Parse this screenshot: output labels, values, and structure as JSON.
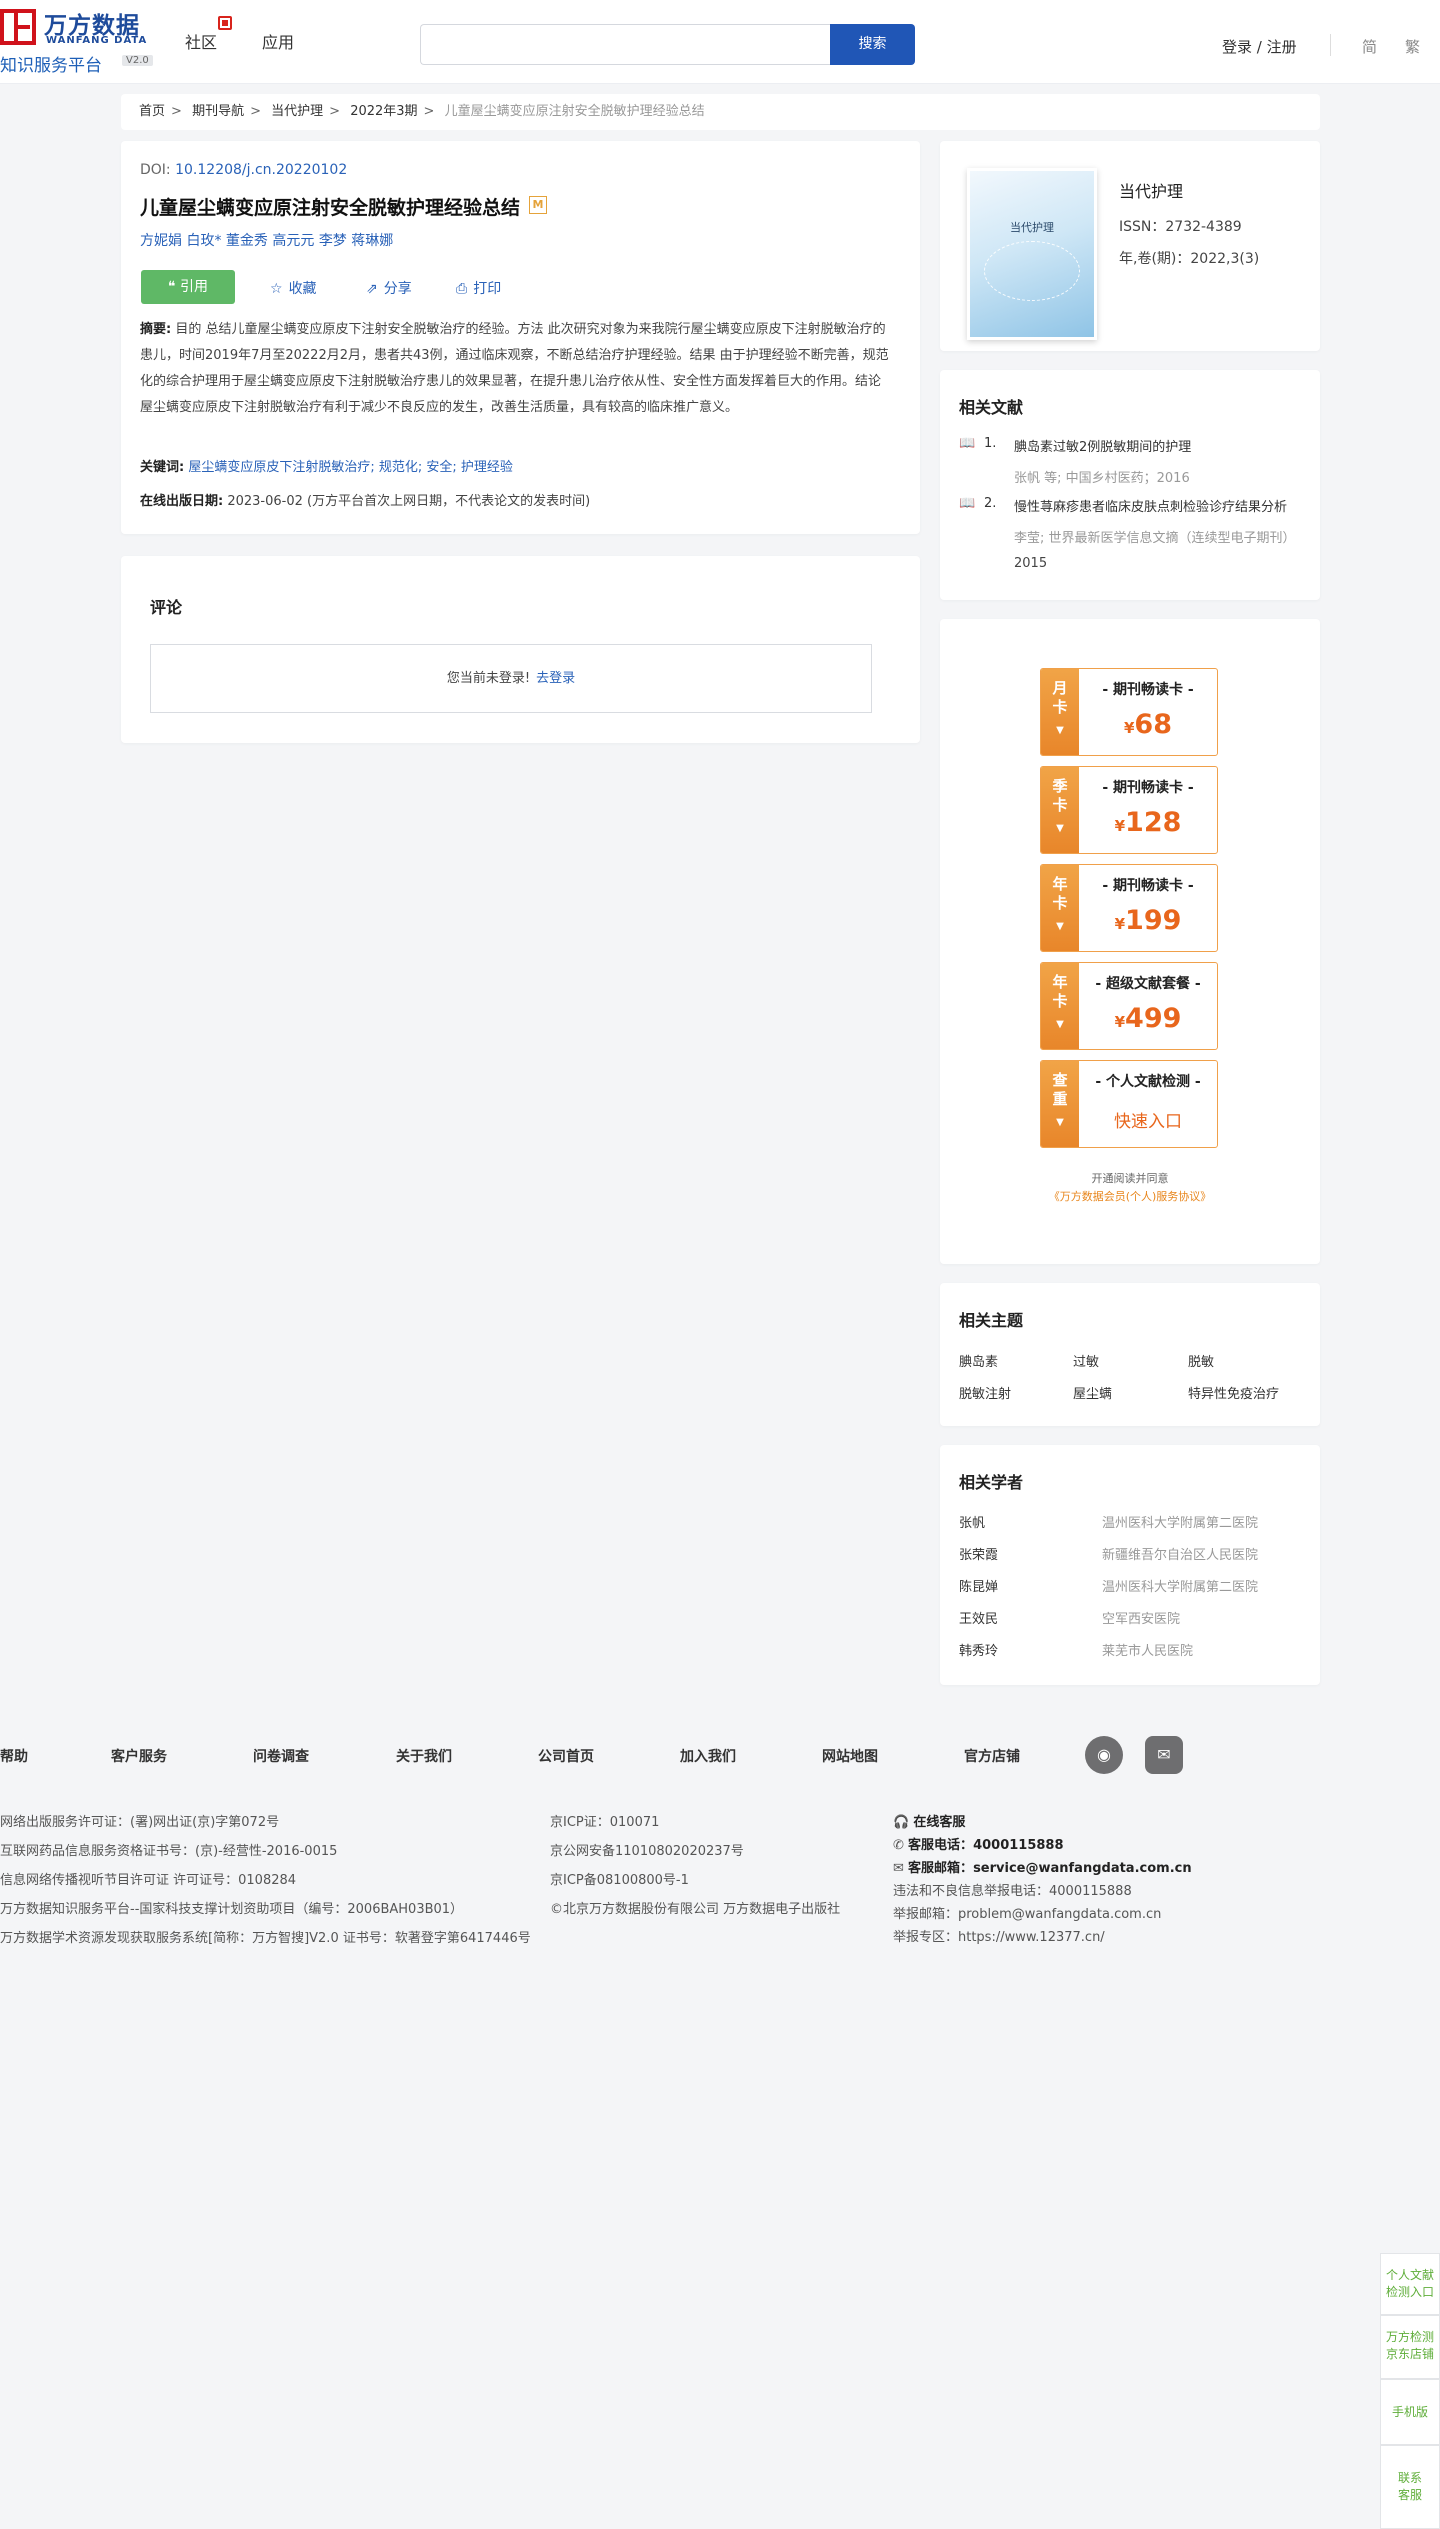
{
  "header": {
    "logo_cn": "万方数据",
    "logo_en": "WANFANG DATA",
    "logo_sub": "知识服务平台",
    "logo_version": "V2.0",
    "nav": [
      "社区",
      "应用"
    ],
    "search_placeholder": "",
    "search_button": "搜索",
    "login": "登录 / 注册",
    "lang_simplified": "简",
    "lang_traditional": "繁"
  },
  "breadcrumb": {
    "items": [
      "首页",
      "期刊导航",
      "当代护理",
      "2022年3期"
    ],
    "current": "儿童屋尘螨变应原注射安全脱敏护理经验总结"
  },
  "article": {
    "doi_label": "DOI: ",
    "doi": "10.12208/j.cn.20220102",
    "title": "儿童屋尘螨变应原注射安全脱敏护理经验总结",
    "badge": "M",
    "authors": [
      "方妮娟",
      "白玫*",
      "董金秀",
      "高元元",
      "李梦",
      "蒋琳娜"
    ],
    "cite_label": "引用",
    "actions": {
      "favorite": "收藏",
      "share": "分享",
      "print": "打印"
    },
    "abstract_label": "摘要:",
    "abstract": " 目的 总结儿童屋尘螨变应原皮下注射安全脱敏治疗的经验。方法 此次研究对象为来我院行屋尘螨变应原皮下注射脱敏治疗的患儿，时间2019年7月至20222月2月，患者共43例，通过临床观察，不断总结治疗护理经验。结果 由于护理经验不断完善，规范化的综合护理用于屋尘螨变应原皮下注射脱敏治疗患儿的效果显著，在提升患儿治疗依从性、安全性方面发挥着巨大的作用。结论 屋尘螨变应原皮下注射脱敏治疗有利于减少不良反应的发生，改善生活质量，具有较高的临床推广意义。",
    "keywords_label": "关键词:",
    "keywords": "屋尘螨变应原皮下注射脱敏治疗; 规范化; 安全; 护理经验",
    "pubdate_label": "在线出版日期:",
    "pubdate": "2023-06-02  (万方平台首次上网日期，不代表论文的发表时间)"
  },
  "comments": {
    "title": "评论",
    "not_logged": "您当前未登录!",
    "login_link": "去登录"
  },
  "journal": {
    "cover_title": "当代护理",
    "name": "当代护理",
    "issn": "ISSN：2732-4389",
    "volume": "年,卷(期)：2022,3(3)"
  },
  "related_docs": {
    "title": "相关文献",
    "items": [
      {
        "num": "1.",
        "title": "腆岛素过敏2例脱敏期间的护理",
        "meta": "张帆  等;  中国乡村医药；2016",
        "year": ""
      },
      {
        "num": "2.",
        "title": "慢性荨麻疹患者临床皮肤点刺检验诊疗结果分析",
        "meta": "李莹; 世界最新医学信息文摘（连续型电子期刊）",
        "year": "2015"
      }
    ]
  },
  "promos": [
    {
      "tag": [
        "月",
        "卡"
      ],
      "head": "- 期刊畅读卡 -",
      "currency": "¥",
      "price": "68"
    },
    {
      "tag": [
        "季",
        "卡"
      ],
      "head": "- 期刊畅读卡 -",
      "currency": "¥",
      "price": "128"
    },
    {
      "tag": [
        "年",
        "卡"
      ],
      "head": "- 期刊畅读卡 -",
      "currency": "¥",
      "price": "199"
    },
    {
      "tag": [
        "年",
        "卡"
      ],
      "head": "- 超级文献套餐 -",
      "currency": "¥",
      "price": "499"
    },
    {
      "tag": [
        "查",
        "重"
      ],
      "head": "- 个人文献检测 -",
      "cta": "快速入口"
    }
  ],
  "agreement": {
    "line1": "开通阅读并同意",
    "line2": "《万方数据会员(个人)服务协议》"
  },
  "topics": {
    "title": "相关主题",
    "items": [
      "腆岛素",
      "过敏",
      "脱敏",
      "脱敏注射",
      "屋尘螨",
      "特异性免疫治疗"
    ]
  },
  "scholars": {
    "title": "相关学者",
    "items": [
      {
        "name": "张帆",
        "org": "温州医科大学附属第二医院"
      },
      {
        "name": "张荣霞",
        "org": "新疆维吾尔自治区人民医院"
      },
      {
        "name": "陈昆婵",
        "org": "温州医科大学附属第二医院"
      },
      {
        "name": "王效民",
        "org": "空军西安医院"
      },
      {
        "name": "韩秀玲",
        "org": "莱芜市人民医院"
      }
    ]
  },
  "footer": {
    "links": [
      "帮助",
      "客户服务",
      "问卷调查",
      "关于我们",
      "公司首页",
      "加入我们",
      "网站地图",
      "官方店铺"
    ],
    "col1": [
      "网络出版服务许可证：(署)网出证(京)字第072号",
      "互联网药品信息服务资格证书号：(京)-经营性-2016-0015",
      "信息网络传播视听节目许可证 许可证号：0108284",
      "万方数据知识服务平台--国家科技支撑计划资助项目（编号：2006BAH03B01）",
      "万方数据学术资源发现获取服务系统[简称：万方智搜]V2.0 证书号：软著登字第6417446号"
    ],
    "col2": [
      "京ICP证：010071",
      "京公网安备11010802020237号",
      "京ICP备08100800号-1",
      "©北京万方数据股份有限公司 万方数据电子出版社"
    ],
    "col3": {
      "online": "在线客服",
      "phone_label": "客服电话：",
      "phone": "4000115888",
      "email_label": "客服邮箱：",
      "email": "service@wanfangdata.com.cn",
      "report_phone": "违法和不良信息举报电话：4000115888",
      "report_email": "举报邮箱：problem@wanfangdata.com.cn",
      "report_zone": "举报专区：https://www.12377.cn/"
    }
  },
  "float": [
    [
      "个人文献",
      "检测入口"
    ],
    [
      "万方检测",
      "京东店铺"
    ],
    [
      "手机版"
    ],
    [
      "联系",
      "客服"
    ]
  ]
}
